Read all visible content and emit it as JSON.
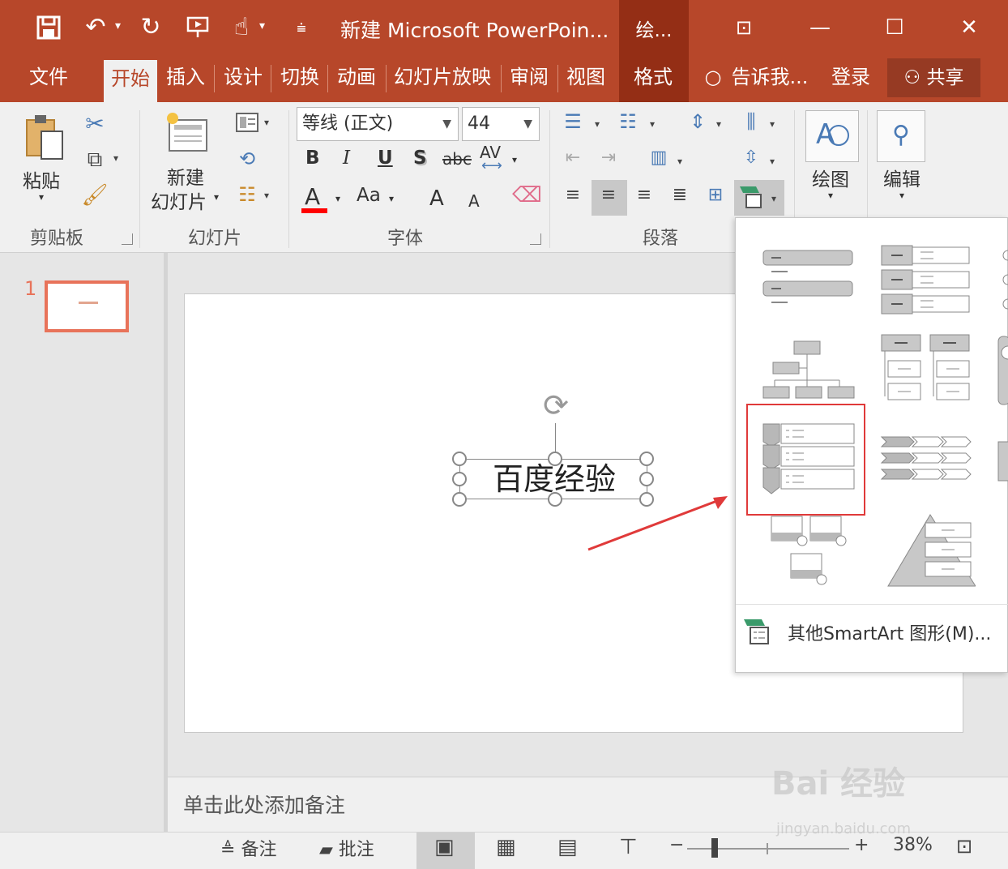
{
  "window": {
    "title": "新建 Microsoft PowerPoin...",
    "context_tab_group": "绘...",
    "controls": {
      "restore": "⊡",
      "minimize": "—",
      "maximize": "☐",
      "close": "✕"
    }
  },
  "quick_access": [
    "save-icon",
    "undo-icon",
    "redo-icon",
    "present-icon",
    "touch-mode-icon",
    "customize-icon"
  ],
  "tabs": [
    "文件",
    "开始",
    "插入",
    "设计",
    "切换",
    "动画",
    "幻灯片放映",
    "审阅",
    "视图",
    "格式"
  ],
  "active_tab": "开始",
  "tell_me": "告诉我...",
  "login": "登录",
  "share": "共享",
  "ribbon": {
    "clipboard": {
      "paste": "粘贴",
      "group": "剪贴板"
    },
    "slides": {
      "new_slide_line1": "新建",
      "new_slide_line2": "幻灯片",
      "group": "幻灯片"
    },
    "font": {
      "font_name": "等线 (正文)",
      "font_size": "44",
      "bold": "B",
      "italic": "I",
      "underline": "U",
      "shadow": "S",
      "strike": "abc",
      "spacing": "AV",
      "color_a": "A",
      "change_case": "Aa",
      "grow": "A",
      "shrink": "A",
      "group": "字体",
      "font_color": "#ff0000"
    },
    "paragraph": {
      "group": "段落"
    },
    "drawing": {
      "label": "绘图"
    },
    "editing": {
      "label": "编辑"
    }
  },
  "slide_panel": {
    "number": "1"
  },
  "slide": {
    "textbox_text": "百度经验"
  },
  "notes_placeholder": "单击此处添加备注",
  "statusbar": {
    "notes": "备注",
    "comments": "批注",
    "zoom": "38%"
  },
  "gallery": {
    "more_label": "其他SmartArt 图形(M)..."
  },
  "watermark": {
    "brand": "Bai 经验",
    "url": "jingyan.baidu.com"
  },
  "colors": {
    "accent": "#b7472a",
    "highlight": "#e03a3a",
    "thumb_border": "#e8735a"
  }
}
